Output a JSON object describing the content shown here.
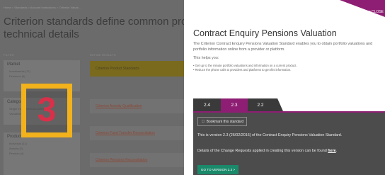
{
  "background": {
    "breadcrumb": "Home > Standards > Account Instructions > Criterion Valuat...",
    "heading": "Criterion standards define common processe technical details",
    "filter_header": "FILTER",
    "refine_header": "REFINE RESULTS",
    "filter_groups": [
      {
        "title": "Market",
        "rows": [
          "Investments (17)",
          "Pensions (9)"
        ]
      },
      {
        "title": "Category",
        "rows": [
          "Single Investment Account (3)",
          "Valuations (2)"
        ]
      },
      {
        "title": "Product",
        "rows": [
          "Individual (11)",
          "Annuity (2)",
          "Pension (4)"
        ]
      }
    ],
    "highlight_row": "Criterion Product Standards",
    "results": [
      "Criterion Annuity Qualification",
      "Criterion Fund Transfer Reconciliation",
      "Criterion Pensions Reconciliation"
    ]
  },
  "countdown": "3",
  "panel": {
    "close_label": "CLOSE",
    "title": "Contract Enquiry Pensions Valuation",
    "description": "The Criterion Contract Enquiry Pensions Valuation Standard enables you to obtain portfolio valuations and portfolio information online from a provider or platform.",
    "helps_label": "This helps you:",
    "bullets": [
      "Get up to the minute portfolio valuations and information on a current product.",
      "Reduce the phone calls to providers and platforms to get this information."
    ],
    "tabs": [
      {
        "label": "2.4",
        "active": false
      },
      {
        "label": "2.3",
        "active": true
      },
      {
        "label": "2.2",
        "active": false
      }
    ],
    "bookmark_label": "Bookmark this standard",
    "version_text": "This is version 2.3 (26/02/2016) of the Contract Enquiry Pensions Valuation Standard.",
    "change_text_prefix": "Details of the Change Requests applied in creating this version can be found ",
    "change_link": "here",
    "change_text_suffix": ".",
    "goto_label": "GO TO VERSION 2.3 >"
  },
  "colors": {
    "accent": "#8e1e73",
    "countdown_border": "#f2b21b",
    "countdown_digit": "#d9304a",
    "goto_button": "#1a8a6b"
  }
}
